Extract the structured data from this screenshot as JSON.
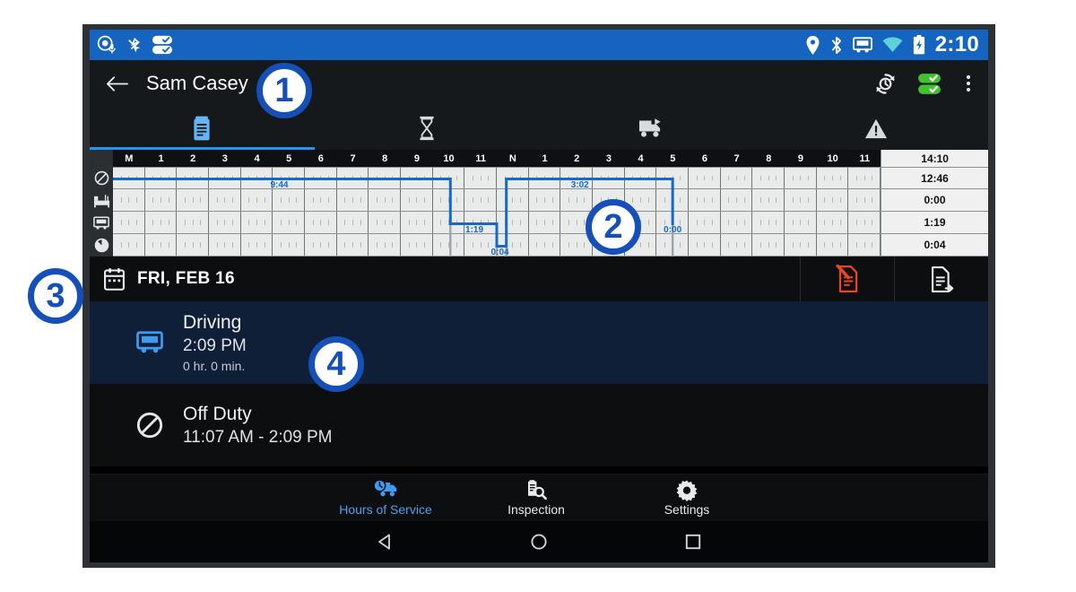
{
  "status_bar": {
    "left_icons": [
      "gps-mic-icon",
      "no-signal-icon",
      "dual-check-icon"
    ],
    "right_icons": [
      "location-pin-icon",
      "bluetooth-icon",
      "truck-icon",
      "wifi-icon",
      "battery-charging-icon"
    ],
    "time": "2:10"
  },
  "app_bar": {
    "back_label": "Back",
    "title": "Sam Casey",
    "icons": [
      "history-clock-icon",
      "green-dual-check-icon",
      "overflow-menu-icon"
    ]
  },
  "tabs": [
    {
      "name": "log",
      "icon": "clipboard-log-icon",
      "active": true
    },
    {
      "name": "hours",
      "icon": "hourglass-icon",
      "active": false
    },
    {
      "name": "vehicle",
      "icon": "truck-trailer-icon",
      "active": false
    },
    {
      "name": "warnings",
      "icon": "warning-triangle-icon",
      "active": false
    }
  ],
  "graph": {
    "hour_labels": [
      "M",
      "1",
      "2",
      "3",
      "4",
      "5",
      "6",
      "7",
      "8",
      "9",
      "10",
      "11",
      "N",
      "1",
      "2",
      "3",
      "4",
      "5",
      "6",
      "7",
      "8",
      "9",
      "10",
      "11"
    ],
    "total_header": "14:10",
    "rows": [
      {
        "status": "off-duty",
        "icon": "off-duty-icon",
        "total": "12:46"
      },
      {
        "status": "sleeper-berth",
        "icon": "sleeper-berth-icon",
        "total": "0:00"
      },
      {
        "status": "driving",
        "icon": "driving-truck-icon",
        "total": "1:19"
      },
      {
        "status": "on-duty",
        "icon": "on-duty-clock-icon",
        "total": "0:04"
      }
    ],
    "segments": [
      {
        "status": "off-duty",
        "start_hour": 0.0,
        "end_hour": 10.55,
        "label": "9:44",
        "label_hour": 5.2
      },
      {
        "status": "driving",
        "start_hour": 10.55,
        "end_hour": 12.0,
        "label": "1:19",
        "label_hour": 11.3
      },
      {
        "status": "on-duty",
        "start_hour": 12.0,
        "end_hour": 12.3,
        "label": "0:04",
        "label_hour": 12.1
      },
      {
        "status": "off-duty",
        "start_hour": 12.3,
        "end_hour": 17.5,
        "label": "3:02",
        "label_hour": 14.6
      },
      {
        "status": "driving",
        "start_hour": 17.5,
        "end_hour": 17.5,
        "label": "0:00",
        "label_hour": 17.5
      }
    ]
  },
  "date_bar": {
    "calendar_icon": "calendar-icon",
    "date": "FRI, FEB 16",
    "actions": [
      {
        "name": "unsigned-log-icon",
        "color": "#e8481f"
      },
      {
        "name": "export-log-icon",
        "color": "#e9ebec"
      }
    ]
  },
  "events": [
    {
      "icon": "driving-truck-icon",
      "title": "Driving",
      "time": "2:09 PM",
      "duration": "0 hr. 0 min.",
      "selected": true
    },
    {
      "icon": "off-duty-icon",
      "title": "Off Duty",
      "time": "11:07 AM - 2:09 PM",
      "duration": "",
      "selected": false
    }
  ],
  "bottom_nav": [
    {
      "icon": "hours-of-service-icon",
      "label": "Hours of Service",
      "active": true
    },
    {
      "icon": "inspection-icon",
      "label": "Inspection",
      "active": false
    },
    {
      "icon": "settings-gear-icon",
      "label": "Settings",
      "active": false
    }
  ],
  "system_nav": [
    "back-triangle-icon",
    "home-circle-icon",
    "recents-square-icon"
  ],
  "callouts": [
    {
      "id": "1",
      "label": "1"
    },
    {
      "id": "2",
      "label": "2"
    },
    {
      "id": "3",
      "label": "3"
    },
    {
      "id": "4",
      "label": "4"
    }
  ],
  "colors": {
    "status_bar_blue": "#1565c0",
    "accent_blue": "#2196f3",
    "graph_line": "#1769c7",
    "callout_blue": "#1550b8",
    "alert_orange": "#e8481f",
    "check_green": "#41c22e"
  }
}
